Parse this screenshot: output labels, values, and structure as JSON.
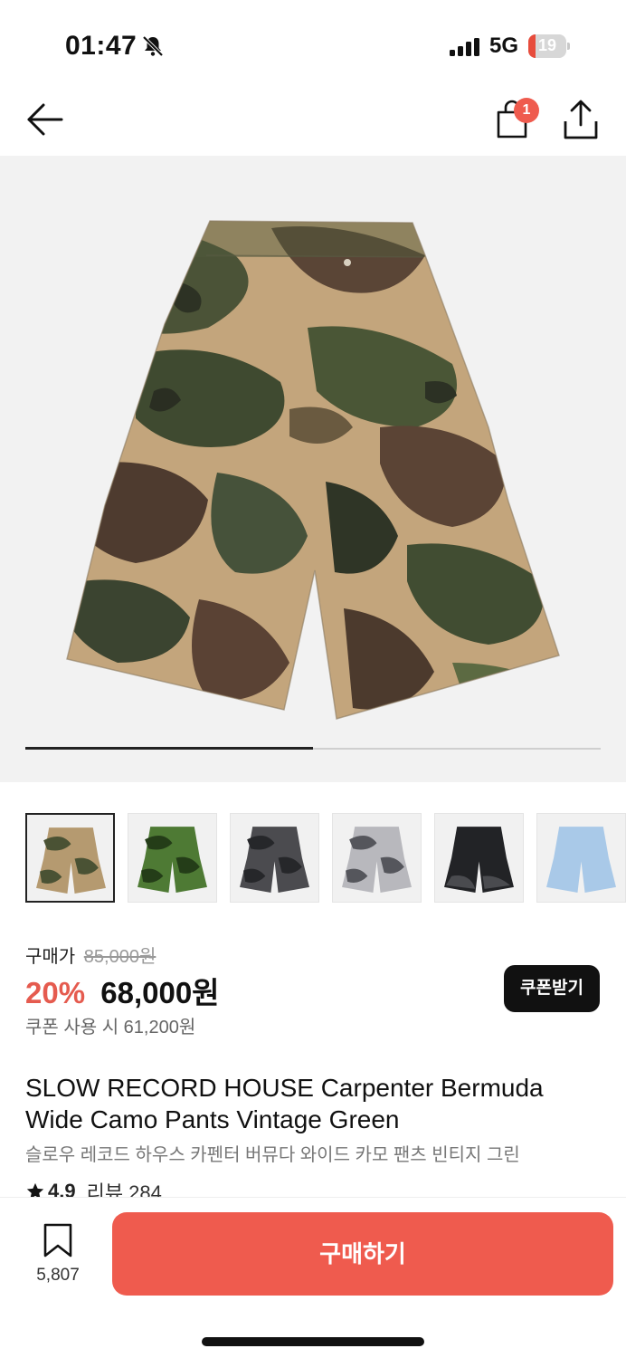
{
  "status_bar": {
    "time": "01:47",
    "network": "5G",
    "battery": "19",
    "battery_level": 0.19,
    "icons": [
      "bell-slash-icon",
      "signal-icon",
      "battery-icon"
    ]
  },
  "nav": {
    "cart_badge": "1",
    "icons": [
      "back-arrow-icon",
      "shopping-bag-icon",
      "share-icon"
    ]
  },
  "gallery": {
    "progress": 0.5,
    "thumbnails": [
      {
        "color": "vintage green camo",
        "active": true
      },
      {
        "color": "green camo",
        "active": false
      },
      {
        "color": "charcoal camo",
        "active": false
      },
      {
        "color": "grey camo",
        "active": false
      },
      {
        "color": "black denim",
        "active": false
      },
      {
        "color": "light blue",
        "active": false
      }
    ]
  },
  "price": {
    "label": "구매가",
    "original": "85,000원",
    "discount": "20%",
    "sale": "68,000원",
    "coupon_note": "쿠폰 사용 시 61,200원",
    "coupon_button": "쿠폰받기"
  },
  "product": {
    "title_en": "SLOW RECORD HOUSE Carpenter Bermuda Wide Camo Pants Vintage Green",
    "title_ko": "슬로우 레코드 하우스 카펜터 버뮤다 와이드 카모 팬츠 빈티지 그린",
    "rating": "4.9",
    "review_label": "리뷰 284"
  },
  "bottom": {
    "bookmark_count": "5,807",
    "buy_label": "구매하기"
  },
  "colors": {
    "accent": "#ef5b4e",
    "discount": "#e55b4f",
    "dark_button": "#111111"
  }
}
